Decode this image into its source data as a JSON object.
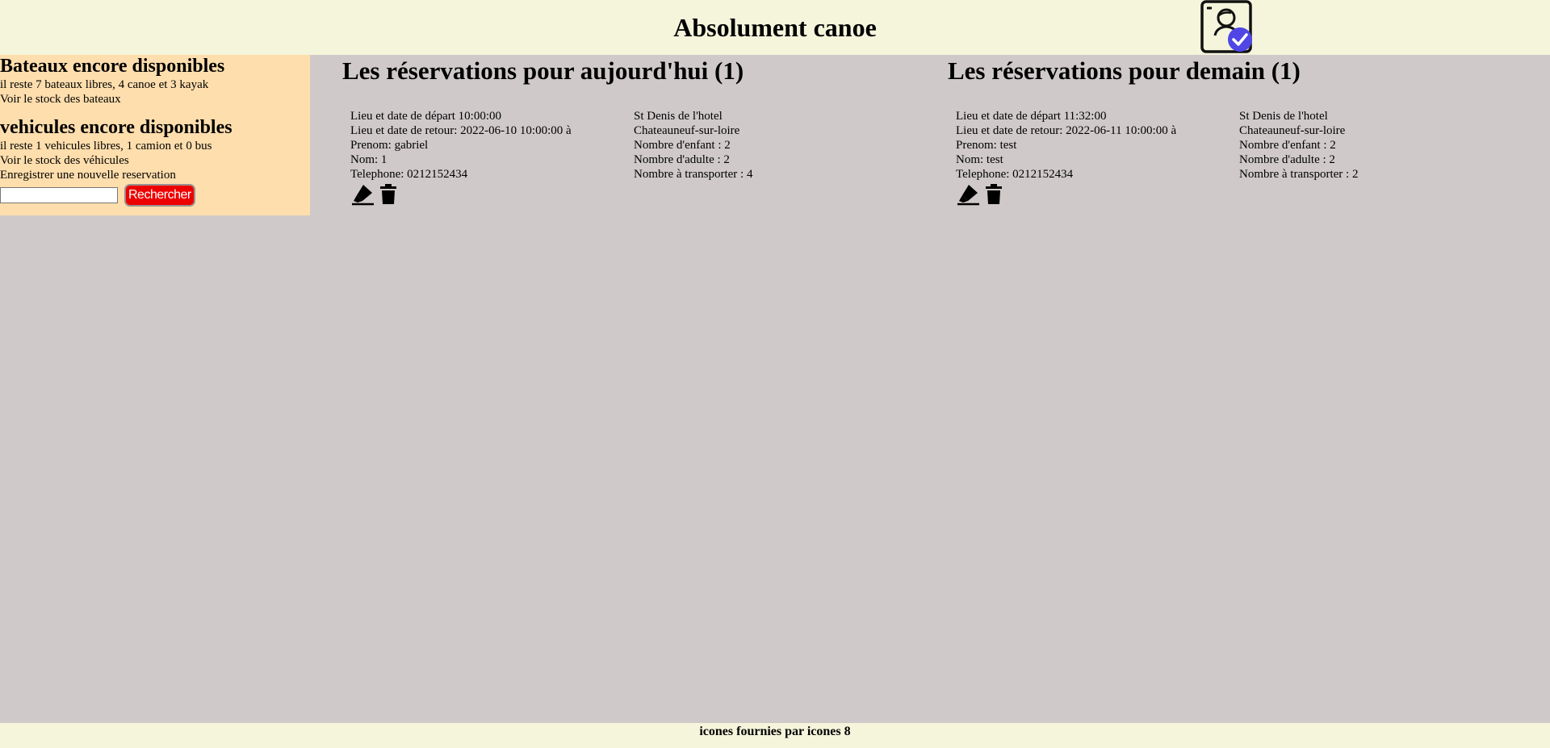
{
  "header": {
    "title": "Absolument canoe",
    "user_icon": "user-profile-check-icon"
  },
  "sidebar": {
    "boats": {
      "heading": "Bateaux encore disponibles",
      "summary": "il reste 7 bateaux libres, 4 canoe et 3 kayak",
      "stock_link": "Voir le stock des bateaux"
    },
    "vehicles": {
      "heading": "vehicules encore disponibles",
      "summary": "il reste 1 vehicules libres, 1 camion et 0 bus",
      "stock_link": "Voir le stock des véhicules"
    },
    "new_reservation_link": "Enregistrer une nouvelle reservation",
    "search": {
      "value": "",
      "button_label": "Rechercher"
    }
  },
  "today": {
    "heading": "Les réservations pour aujourd'hui (1)",
    "reservation": {
      "departure": "Lieu et date de départ 10:00:00",
      "return": "Lieu et date de retour: 2022-06-10 10:00:00 à",
      "first_name": "Prenom: gabriel",
      "last_name": "Nom: 1",
      "phone": "Telephone: 0212152434",
      "departure_place": "St Denis de l'hotel",
      "return_place": "Chateauneuf-sur-loire",
      "children": "Nombre d'enfant : 2",
      "adults": "Nombre d'adulte : 2",
      "to_transport": "Nombre à transporter : 4"
    }
  },
  "tomorrow": {
    "heading": "Les réservations pour demain (1)",
    "reservation": {
      "departure": "Lieu et date de départ 11:32:00",
      "return": "Lieu et date de retour: 2022-06-11 10:00:00 à",
      "first_name": "Prenom: test",
      "last_name": "Nom: test",
      "phone": "Telephone: 0212152434",
      "departure_place": "St Denis de l'hotel",
      "return_place": "Chateauneuf-sur-loire",
      "children": "Nombre d'enfant : 2",
      "adults": "Nombre d'adulte : 2",
      "to_transport": "Nombre à transporter : 2"
    }
  },
  "footer": {
    "credit": "icones fournies par icones 8"
  },
  "colors": {
    "header_bg": "#f5f5dc",
    "sidebar_bg": "#ffdead",
    "main_bg": "#cfc9ca",
    "button_bg": "#ee0000",
    "badge_blue": "#4f46e5"
  }
}
